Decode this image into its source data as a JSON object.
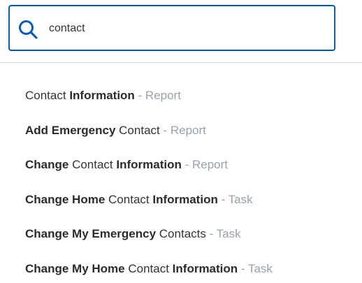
{
  "search": {
    "value": "contact",
    "icon": "search-icon",
    "border_color": "#0b5cab"
  },
  "results": [
    {
      "parts": [
        {
          "text": "Contact ",
          "bold": false
        },
        {
          "text": "Information",
          "bold": true
        }
      ],
      "type": " - Report"
    },
    {
      "parts": [
        {
          "text": "Add Emergency ",
          "bold": true
        },
        {
          "text": "Contact",
          "bold": false
        }
      ],
      "type": " - Report"
    },
    {
      "parts": [
        {
          "text": "Change ",
          "bold": true
        },
        {
          "text": "Contact ",
          "bold": false
        },
        {
          "text": "Information",
          "bold": true
        }
      ],
      "type": " - Report"
    },
    {
      "parts": [
        {
          "text": "Change Home ",
          "bold": true
        },
        {
          "text": "Contact ",
          "bold": false
        },
        {
          "text": "Information",
          "bold": true
        }
      ],
      "type": " - Task"
    },
    {
      "parts": [
        {
          "text": "Change My Emergency ",
          "bold": true
        },
        {
          "text": "Contacts",
          "bold": false
        }
      ],
      "type": " - Task"
    },
    {
      "parts": [
        {
          "text": "Change My Home ",
          "bold": true
        },
        {
          "text": "Contact ",
          "bold": false
        },
        {
          "text": "Information",
          "bold": true
        }
      ],
      "type": " - Task"
    }
  ]
}
